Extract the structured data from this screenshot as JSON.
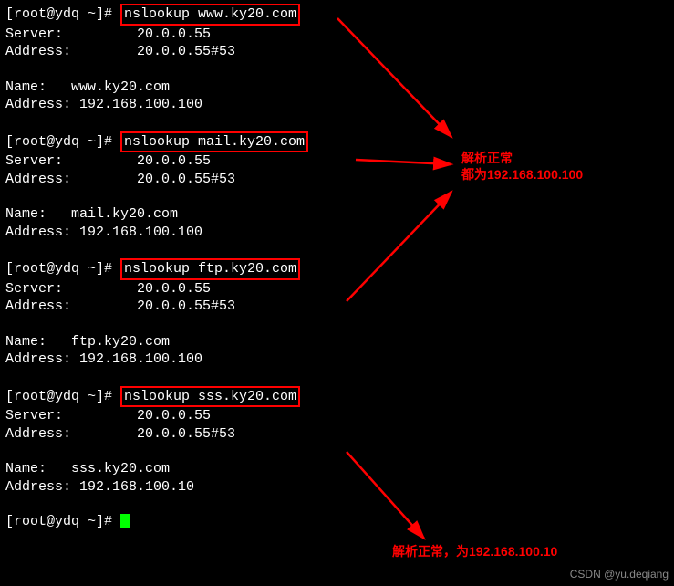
{
  "prompt": "[root@ydq ~]# ",
  "cmd1": "nslookup www.ky20.com",
  "cmd2": "nslookup mail.ky20.com",
  "cmd3": "nslookup ftp.ky20.com",
  "cmd4": "nslookup sss.ky20.com",
  "server_line": "Server:         20.0.0.55",
  "address_line": "Address:        20.0.0.55#53",
  "name1": "Name:   www.ky20.com",
  "addr1": "Address: 192.168.100.100",
  "name2": "Name:   mail.ky20.com",
  "addr2": "Address: 192.168.100.100",
  "name3": "Name:   ftp.ky20.com",
  "addr3": "Address: 192.168.100.100",
  "name4": "Name:   sss.ky20.com",
  "addr4": "Address: 192.168.100.10",
  "prompt_trail": "[root@ydq ~]# ",
  "annotation1_line1": "解析正常",
  "annotation1_line2": "都为192.168.100.100",
  "annotation2": "解析正常，为192.168.100.10",
  "watermark": "CSDN @yu.deqiang"
}
